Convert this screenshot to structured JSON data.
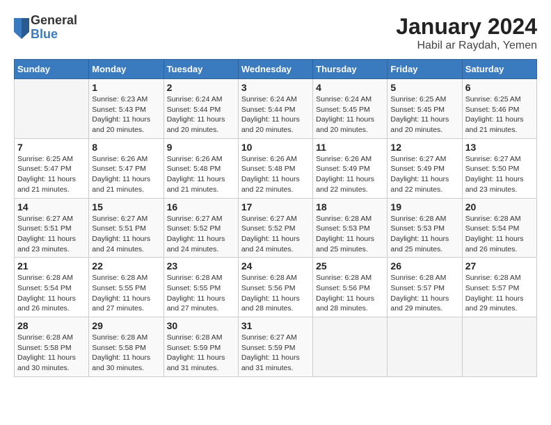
{
  "header": {
    "logo_general": "General",
    "logo_blue": "Blue",
    "title": "January 2024",
    "subtitle": "Habil ar Raydah, Yemen"
  },
  "calendar": {
    "days_of_week": [
      "Sunday",
      "Monday",
      "Tuesday",
      "Wednesday",
      "Thursday",
      "Friday",
      "Saturday"
    ],
    "weeks": [
      [
        {
          "day": "",
          "info": ""
        },
        {
          "day": "1",
          "info": "Sunrise: 6:23 AM\nSunset: 5:43 PM\nDaylight: 11 hours\nand 20 minutes."
        },
        {
          "day": "2",
          "info": "Sunrise: 6:24 AM\nSunset: 5:44 PM\nDaylight: 11 hours\nand 20 minutes."
        },
        {
          "day": "3",
          "info": "Sunrise: 6:24 AM\nSunset: 5:44 PM\nDaylight: 11 hours\nand 20 minutes."
        },
        {
          "day": "4",
          "info": "Sunrise: 6:24 AM\nSunset: 5:45 PM\nDaylight: 11 hours\nand 20 minutes."
        },
        {
          "day": "5",
          "info": "Sunrise: 6:25 AM\nSunset: 5:45 PM\nDaylight: 11 hours\nand 20 minutes."
        },
        {
          "day": "6",
          "info": "Sunrise: 6:25 AM\nSunset: 5:46 PM\nDaylight: 11 hours\nand 21 minutes."
        }
      ],
      [
        {
          "day": "7",
          "info": "Sunrise: 6:25 AM\nSunset: 5:47 PM\nDaylight: 11 hours\nand 21 minutes."
        },
        {
          "day": "8",
          "info": "Sunrise: 6:26 AM\nSunset: 5:47 PM\nDaylight: 11 hours\nand 21 minutes."
        },
        {
          "day": "9",
          "info": "Sunrise: 6:26 AM\nSunset: 5:48 PM\nDaylight: 11 hours\nand 21 minutes."
        },
        {
          "day": "10",
          "info": "Sunrise: 6:26 AM\nSunset: 5:48 PM\nDaylight: 11 hours\nand 22 minutes."
        },
        {
          "day": "11",
          "info": "Sunrise: 6:26 AM\nSunset: 5:49 PM\nDaylight: 11 hours\nand 22 minutes."
        },
        {
          "day": "12",
          "info": "Sunrise: 6:27 AM\nSunset: 5:49 PM\nDaylight: 11 hours\nand 22 minutes."
        },
        {
          "day": "13",
          "info": "Sunrise: 6:27 AM\nSunset: 5:50 PM\nDaylight: 11 hours\nand 23 minutes."
        }
      ],
      [
        {
          "day": "14",
          "info": "Sunrise: 6:27 AM\nSunset: 5:51 PM\nDaylight: 11 hours\nand 23 minutes."
        },
        {
          "day": "15",
          "info": "Sunrise: 6:27 AM\nSunset: 5:51 PM\nDaylight: 11 hours\nand 24 minutes."
        },
        {
          "day": "16",
          "info": "Sunrise: 6:27 AM\nSunset: 5:52 PM\nDaylight: 11 hours\nand 24 minutes."
        },
        {
          "day": "17",
          "info": "Sunrise: 6:27 AM\nSunset: 5:52 PM\nDaylight: 11 hours\nand 24 minutes."
        },
        {
          "day": "18",
          "info": "Sunrise: 6:28 AM\nSunset: 5:53 PM\nDaylight: 11 hours\nand 25 minutes."
        },
        {
          "day": "19",
          "info": "Sunrise: 6:28 AM\nSunset: 5:53 PM\nDaylight: 11 hours\nand 25 minutes."
        },
        {
          "day": "20",
          "info": "Sunrise: 6:28 AM\nSunset: 5:54 PM\nDaylight: 11 hours\nand 26 minutes."
        }
      ],
      [
        {
          "day": "21",
          "info": "Sunrise: 6:28 AM\nSunset: 5:54 PM\nDaylight: 11 hours\nand 26 minutes."
        },
        {
          "day": "22",
          "info": "Sunrise: 6:28 AM\nSunset: 5:55 PM\nDaylight: 11 hours\nand 27 minutes."
        },
        {
          "day": "23",
          "info": "Sunrise: 6:28 AM\nSunset: 5:55 PM\nDaylight: 11 hours\nand 27 minutes."
        },
        {
          "day": "24",
          "info": "Sunrise: 6:28 AM\nSunset: 5:56 PM\nDaylight: 11 hours\nand 28 minutes."
        },
        {
          "day": "25",
          "info": "Sunrise: 6:28 AM\nSunset: 5:56 PM\nDaylight: 11 hours\nand 28 minutes."
        },
        {
          "day": "26",
          "info": "Sunrise: 6:28 AM\nSunset: 5:57 PM\nDaylight: 11 hours\nand 29 minutes."
        },
        {
          "day": "27",
          "info": "Sunrise: 6:28 AM\nSunset: 5:57 PM\nDaylight: 11 hours\nand 29 minutes."
        }
      ],
      [
        {
          "day": "28",
          "info": "Sunrise: 6:28 AM\nSunset: 5:58 PM\nDaylight: 11 hours\nand 30 minutes."
        },
        {
          "day": "29",
          "info": "Sunrise: 6:28 AM\nSunset: 5:58 PM\nDaylight: 11 hours\nand 30 minutes."
        },
        {
          "day": "30",
          "info": "Sunrise: 6:28 AM\nSunset: 5:59 PM\nDaylight: 11 hours\nand 31 minutes."
        },
        {
          "day": "31",
          "info": "Sunrise: 6:27 AM\nSunset: 5:59 PM\nDaylight: 11 hours\nand 31 minutes."
        },
        {
          "day": "",
          "info": ""
        },
        {
          "day": "",
          "info": ""
        },
        {
          "day": "",
          "info": ""
        }
      ]
    ]
  }
}
